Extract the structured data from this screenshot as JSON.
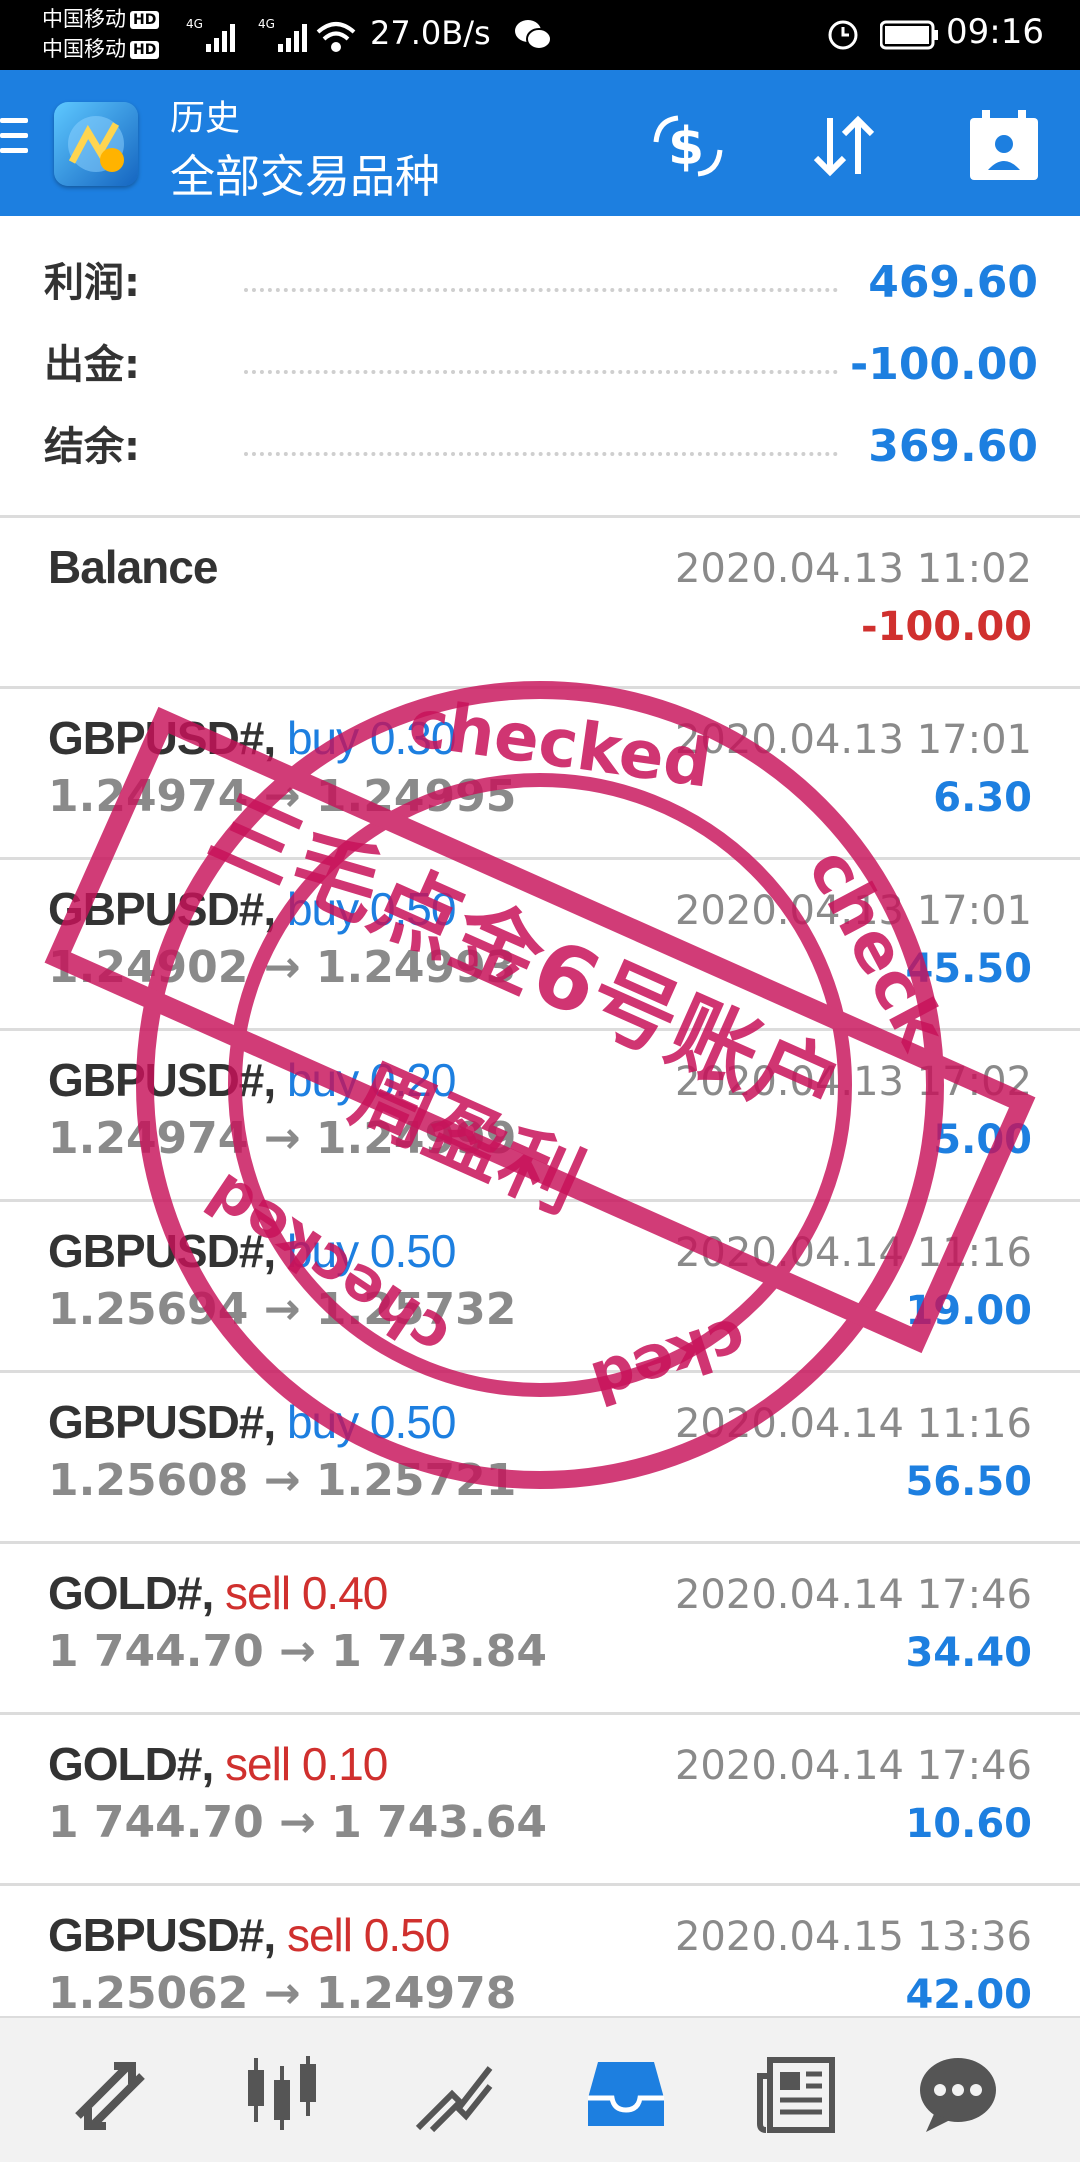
{
  "status_bar": {
    "carrier_1": "中国移动",
    "carrier_2": "中国移动",
    "hd_badge": "HD",
    "network": "4G",
    "speed": "27.0B/s",
    "time": "09:16",
    "icons": [
      "signal-icon",
      "wifi-icon",
      "wechat-icon",
      "alarm-icon",
      "battery-icon"
    ]
  },
  "header": {
    "subtitle": "历史",
    "title": "全部交易品种",
    "icons": [
      "menu-icon",
      "metatrader-logo-icon",
      "deposit-dollar-icon",
      "sort-icon",
      "calendar-person-icon"
    ]
  },
  "summary": [
    {
      "label": "利润:",
      "value": "469.60"
    },
    {
      "label": "出金:",
      "value": "-100.00"
    },
    {
      "label": "结余:",
      "value": "369.60"
    }
  ],
  "trades": [
    {
      "symbol": "Balance",
      "side": "",
      "prices": "",
      "time": "2020.04.13 11:02",
      "profit": "-100.00",
      "sign": "neg"
    },
    {
      "symbol": "GBPUSD#,",
      "side": "buy 0.30",
      "side_type": "buy",
      "prices": "1.24974 → 1.24995",
      "time": "2020.04.13 17:01",
      "profit": "6.30",
      "sign": "pos"
    },
    {
      "symbol": "GBPUSD#,",
      "side": "buy 0.50",
      "side_type": "buy",
      "prices": "1.24902 → 1.24993",
      "time": "2020.04.13 17:01",
      "profit": "45.50",
      "sign": "pos"
    },
    {
      "symbol": "GBPUSD#,",
      "side": "buy 0.20",
      "side_type": "buy",
      "prices": "1.24974 → 1.24999",
      "time": "2020.04.13 17:02",
      "profit": "5.00",
      "sign": "pos"
    },
    {
      "symbol": "GBPUSD#,",
      "side": "buy 0.50",
      "side_type": "buy",
      "prices": "1.25694 → 1.25732",
      "time": "2020.04.14 11:16",
      "profit": "19.00",
      "sign": "pos"
    },
    {
      "symbol": "GBPUSD#,",
      "side": "buy 0.50",
      "side_type": "buy",
      "prices": "1.25608 → 1.25721",
      "time": "2020.04.14 11:16",
      "profit": "56.50",
      "sign": "pos"
    },
    {
      "symbol": "GOLD#,",
      "side": "sell 0.40",
      "side_type": "sell",
      "prices": "1 744.70 → 1 743.84",
      "time": "2020.04.14 17:46",
      "profit": "34.40",
      "sign": "pos"
    },
    {
      "symbol": "GOLD#,",
      "side": "sell 0.10",
      "side_type": "sell",
      "prices": "1 744.70 → 1 743.64",
      "time": "2020.04.14 17:46",
      "profit": "10.60",
      "sign": "pos"
    },
    {
      "symbol": "GBPUSD#,",
      "side": "sell 0.50",
      "side_type": "sell",
      "prices": "1.25062 → 1.24978",
      "time": "2020.04.15 13:36",
      "profit": "42.00",
      "sign": "pos"
    }
  ],
  "bottom_nav": [
    "quotes-icon",
    "chart-candles-icon",
    "trade-icon",
    "history-inbox-icon",
    "news-icon",
    "chat-icon"
  ],
  "stamp": {
    "line1": "三毛点金6号账户",
    "line2": "周盈利",
    "ring_top": "checked",
    "ring_right": "check",
    "ring_bottom_left": "checked",
    "ring_bottom_right": "cked",
    "color": "#c8125a"
  },
  "colors": {
    "accent": "#1d7fe0",
    "negative": "#d0302e",
    "muted": "#8a8a8a"
  }
}
